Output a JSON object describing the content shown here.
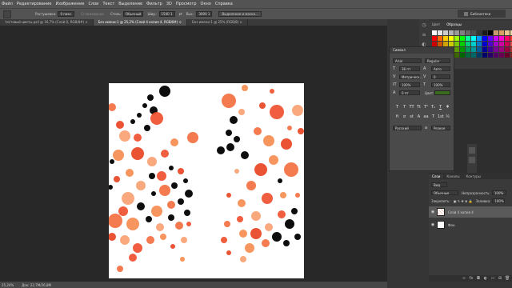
{
  "menu": [
    "Файл",
    "Редактирование",
    "Изображение",
    "Слои",
    "Текст",
    "Выделение",
    "Фильтр",
    "3D",
    "Просмотр",
    "Окно",
    "Справка"
  ],
  "options": {
    "feather_label": "Растушевка:",
    "feather_value": "0 пикс.",
    "antialias": "Сглаживание",
    "style_label": "Стиль:",
    "style_value": "Обычный",
    "width_label": "Шир.:",
    "width_value": "1500 1",
    "height_label": "Выс.:",
    "height_value": "3000 1",
    "select_mask": "Выделение и маска..."
  },
  "tabs": [
    {
      "label": "тестовый-цветы.psd @ 16,7% (Слой 0, RGB/8#) ×",
      "active": false
    },
    {
      "label": "Без имени-1 @ 25,2% (Слой 4 копия 4, RGB/8#) ×",
      "active": true
    },
    {
      "label": "Без имени-1 @ 25% (RGB/8) ×",
      "active": false
    }
  ],
  "status": {
    "zoom": "25,24%",
    "doc": "Док: 22,7M/26,8М"
  },
  "library_button": "Библиотеки",
  "swatch_tabs": [
    "Цвет",
    "Образцы"
  ],
  "swatch_colors": [
    "#ffffff",
    "#e6e6e6",
    "#cccccc",
    "#b3b3b3",
    "#999999",
    "#808080",
    "#666666",
    "#4d4d4d",
    "#333333",
    "#1a1a1a",
    "#000000",
    "#c89b6e",
    "#d9a066",
    "#e8c48b",
    "#f0d9a8",
    "#fbe7c6",
    "#ff0000",
    "#ff6600",
    "#ffcc00",
    "#ffff00",
    "#99ff00",
    "#00ff00",
    "#00ff99",
    "#00ffff",
    "#0099ff",
    "#0000ff",
    "#6600ff",
    "#cc00ff",
    "#ff00cc",
    "#ff0066",
    "#ff3333",
    "#ff9966",
    "#cc0000",
    "#cc5200",
    "#cca300",
    "#cccc00",
    "#7acc00",
    "#00cc00",
    "#00cc7a",
    "#00cccc",
    "#007acc",
    "#0000cc",
    "#5200cc",
    "#a300cc",
    "#cc00a3",
    "#cc0052",
    "#e64d4d",
    "#e6997a",
    "#990000",
    "#993d00",
    "#997a00",
    "#999900",
    "#5c9900",
    "#009900",
    "#00995c",
    "#009999",
    "#005c99",
    "#000099",
    "#3d0099",
    "#7a0099",
    "#99007a",
    "#99003d",
    "#b33333",
    "#b37a5c",
    "#660000",
    "#662900",
    "#665200",
    "#666600",
    "#3d6600",
    "#006600",
    "#00663d",
    "#006666",
    "#003d66",
    "#000066",
    "#290066",
    "#520066",
    "#660052",
    "#660029",
    "#802020",
    "#804d33"
  ],
  "character": {
    "title": "Символ",
    "font": "Arial",
    "style": "Regular",
    "size": "36 пт",
    "leading": "Авто",
    "tracking_label": "Метрическ...",
    "tracking": "0",
    "vscale": "100%",
    "hscale": "100%",
    "baseline": "0 пт",
    "color_label": "Цвет:",
    "color": "#3a6b1f",
    "language": "Русский",
    "aa": "Резкое"
  },
  "layers": {
    "tabs": [
      "Слои",
      "Каналы",
      "Контуры"
    ],
    "filter": "Вид",
    "blend": "Обычные",
    "opacity_label": "Непрозрачность:",
    "opacity": "100%",
    "lock_label": "Закрепить:",
    "fill_label": "Заливка:",
    "fill": "100%",
    "items": [
      {
        "name": "Слой 4 копия 4",
        "selected": true
      },
      {
        "name": "Фон",
        "selected": false
      }
    ]
  }
}
